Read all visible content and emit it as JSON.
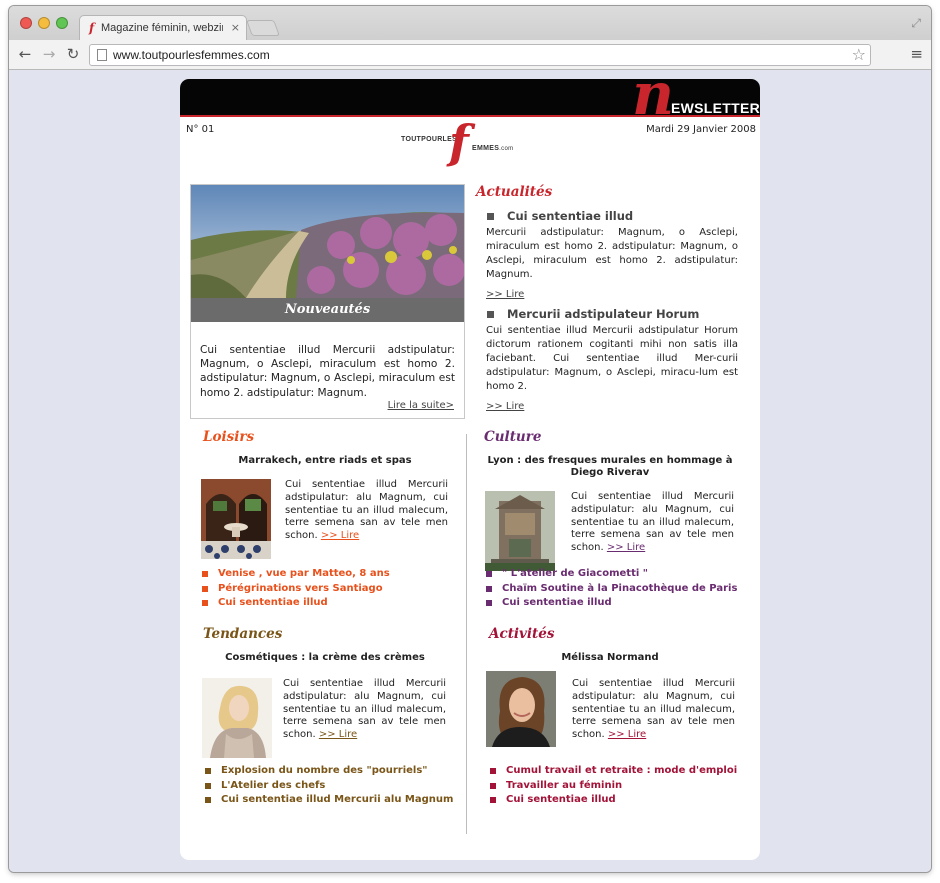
{
  "browser": {
    "tab_title": "Magazine féminin, webzine",
    "tab_close": "×",
    "url": "www.toutpourlesfemmes.com",
    "icons": [
      "back-arrow-icon",
      "forward-arrow-icon",
      "reload-icon",
      "page-icon",
      "star-icon",
      "menu-icon",
      "fullscreen-icon"
    ]
  },
  "header": {
    "big_letter": "n",
    "word": "EWSLETTER",
    "issue": "N° 01",
    "date": "Mardi 29 Janvier 2008"
  },
  "logo": {
    "left": "TOUTPOURLES",
    "letter": "f",
    "right": "EMMES",
    "suffix": ".com"
  },
  "feature": {
    "title": "Nouveautés",
    "text": "Cui sententiae illud Mercurii adstipulatur: Magnum, o Asclepi, miraculum est homo 2. adstipulatur: Magnum, o Asclepi, miraculum est homo 2. adstipulatur: Magnum.",
    "more": "Lire la suite>"
  },
  "actualites": {
    "title": "Actualités",
    "items": [
      {
        "heading": "Cui sententiae illud",
        "text": "Mercurii adstipulatur: Magnum, o Asclepi, miraculum est homo 2. adstipulatur: Magnum, o Asclepi, miraculum est homo 2. adstipulatur: Magnum.",
        "link": ">> Lire"
      },
      {
        "heading": "Mercurii adstipulateur Horum",
        "text": "Cui sententiae illud Mercurii adstipulatur Horum dictorum rationem cogitanti mihi non satis illa faciebant. Cui sententiae illud Mer-curii adstipulatur: Magnum, o Asclepi, miracu-lum est homo 2.",
        "link": ">> Lire"
      }
    ]
  },
  "sections": {
    "loisirs": {
      "title": "Loisirs",
      "color": "#e8511c",
      "headline": "Marrakech, entre riads et spas",
      "text": "Cui sententiae illud Mercurii adstipulatur: alu Magnum, cui sententiae tu an illud malecum, terre semena san av tele men schon.",
      "link": ">> Lire",
      "bullets": [
        "Venise , vue par Matteo, 8 ans",
        "Pérégrinations vers Santiago",
        "Cui sententiae illud"
      ]
    },
    "culture": {
      "title": "Culture",
      "color": "#6a2c70",
      "headline": "Lyon : des fresques murales en hommage à Diego Riverav",
      "text": "Cui sententiae illud Mercurii adstipulatur: alu Magnum, cui sententiae tu an illud malecum, terre semena san av tele men schon.",
      "link": ">> Lire",
      "bullets": [
        "\" L'atelier de Giacometti \"",
        "Chaïm Soutine à la Pinacothèque de Paris",
        "Cui sententiae illud"
      ]
    },
    "tendances": {
      "title": "Tendances",
      "color": "#7a5518",
      "headline": "Cosmétiques : la crème des crèmes",
      "text": "Cui sententiae illud Mercurii adstipulatur: alu Magnum, cui sententiae tu an illud malecum, terre semena san av tele men schon.",
      "link": ">> Lire",
      "bullets": [
        "Explosion du nombre des \"pourriels\"",
        "L'Atelier des chefs",
        "Cui sententiae illud Mercurii alu Magnum"
      ]
    },
    "activites": {
      "title": "Activités",
      "color": "#a31237",
      "headline": "Mélissa Normand",
      "text": "Cui sententiae illud Mercurii adstipulatur: alu Magnum, cui sententiae tu an illud malecum, terre semena san av tele men schon.",
      "link": ">> Lire",
      "bullets": [
        "Cumul travail et retraite : mode d'emploi",
        "Travailler au féminin",
        "Cui sententiae illud"
      ]
    }
  }
}
